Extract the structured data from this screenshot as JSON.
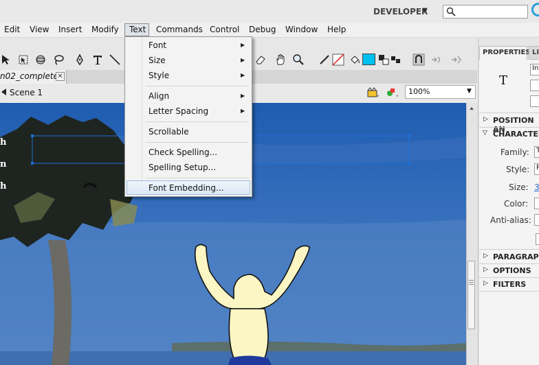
{
  "workspace": {
    "label": "DEVELOPER"
  },
  "menu": {
    "items": [
      "Edit",
      "View",
      "Insert",
      "Modify",
      "Text",
      "Commands",
      "Control",
      "Debug",
      "Window",
      "Help"
    ],
    "active": "Text"
  },
  "dropdown": {
    "items": [
      {
        "label": "Font",
        "submenu": true
      },
      {
        "label": "Size",
        "submenu": true
      },
      {
        "label": "Style",
        "submenu": true
      },
      {
        "label": "Align",
        "submenu": true
      },
      {
        "label": "Letter Spacing",
        "submenu": true
      },
      {
        "label": "Scrollable",
        "submenu": false
      },
      {
        "label": "Check Spelling...",
        "submenu": false
      },
      {
        "label": "Spelling Setup...",
        "submenu": false
      },
      {
        "label": "Font Embedding...",
        "submenu": false,
        "highlighted": true
      }
    ]
  },
  "document": {
    "tab_label": "n02_complete*",
    "close_glyph": "✕"
  },
  "scene": {
    "label": "Scene 1"
  },
  "zoom": {
    "value": "100%"
  },
  "stage": {
    "text_fragments": [
      "h",
      "n",
      "h"
    ],
    "colors": {
      "sky_top": "#2a64b5",
      "sky_bottom": "#5d8fcf",
      "water": "#3f6fae",
      "figure": "#fbf6c4"
    }
  },
  "panel": {
    "tabs": [
      "PROPERTIES",
      "LI"
    ],
    "tool_glyph": "T",
    "instance_value": "Int",
    "sections": [
      "POSITION AN",
      "CHARACTER",
      "PARAGRAPH",
      "OPTIONS",
      "FILTERS"
    ],
    "fields": {
      "family_label": "Family:",
      "family_value": "T",
      "style_label": "Style:",
      "style_value": "R",
      "size_label": "Size:",
      "size_value": "3",
      "color_label": "Color:",
      "antialias_label": "Anti-alias:"
    }
  }
}
